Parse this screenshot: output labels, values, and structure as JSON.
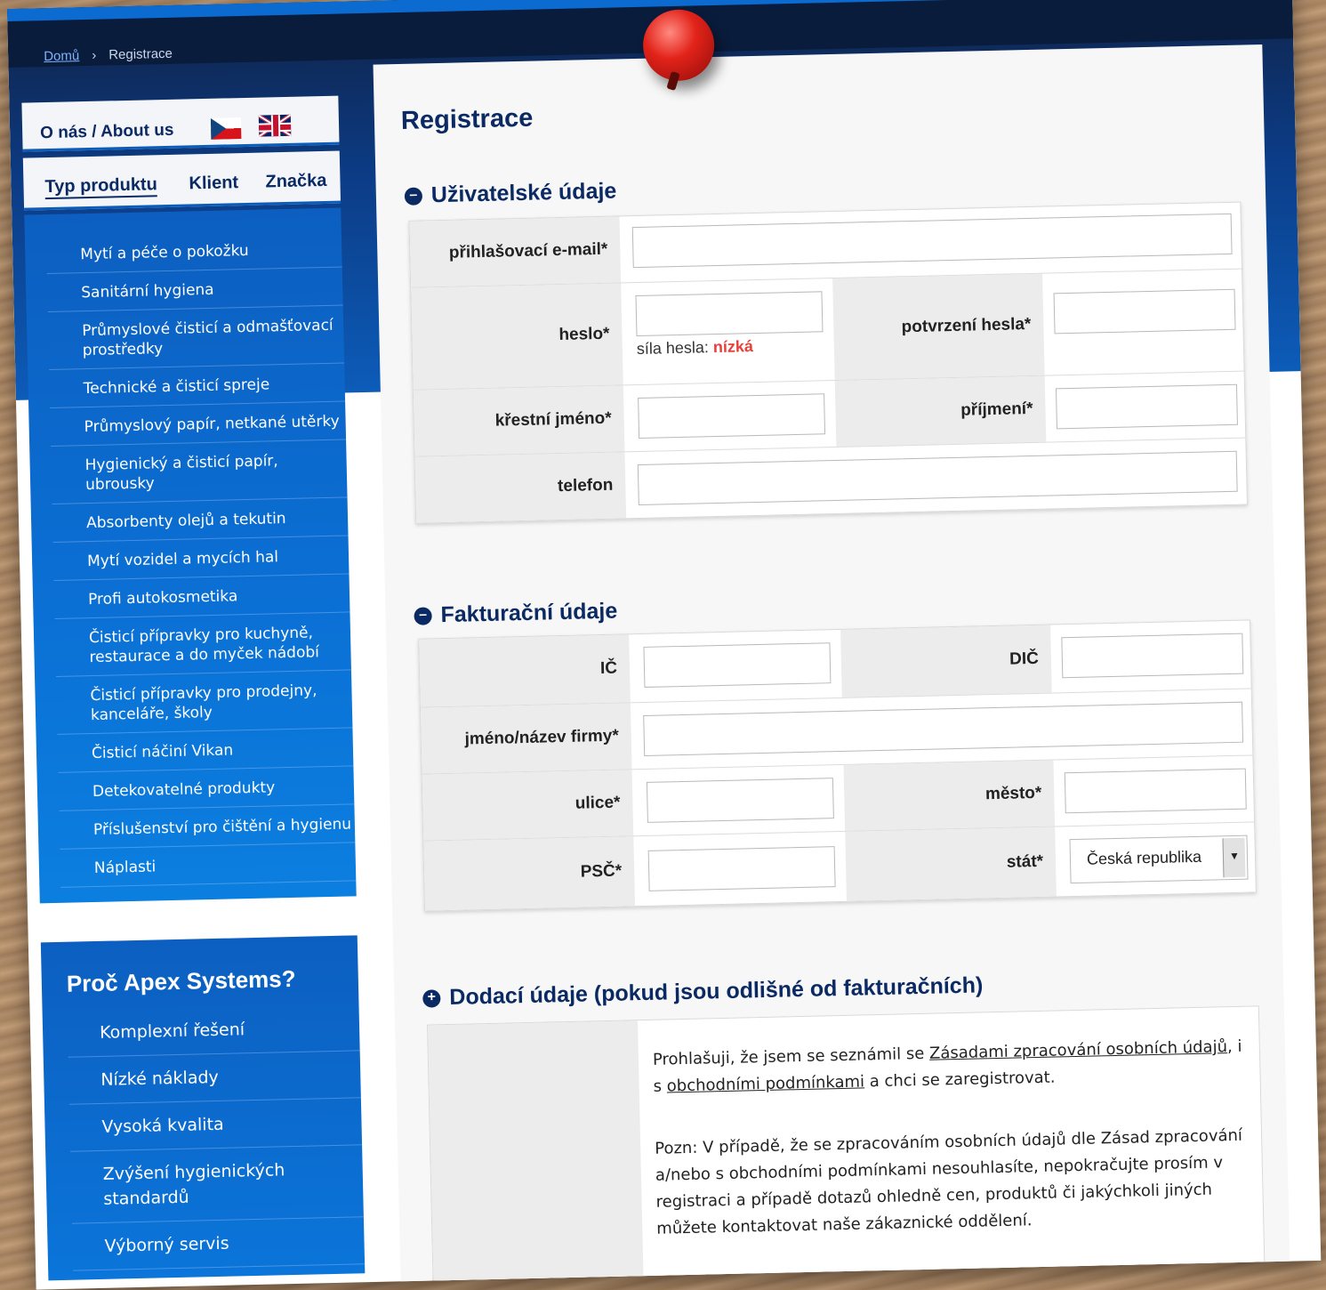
{
  "breadcrumb": {
    "home": "Domů",
    "current": "Registrace"
  },
  "lang": {
    "label": "O nás / About us"
  },
  "tabs": {
    "product_type": "Typ produktu",
    "client": "Klient",
    "brand": "Značka"
  },
  "categories": [
    "Mytí a péče o pokožku",
    "Sanitární hygiena",
    "Průmyslové čisticí a odmašťovací prostředky",
    "Technické a čisticí spreje",
    "Průmyslový papír, netkané utěrky",
    "Hygienický a čisticí papír, ubrousky",
    "Absorbenty olejů a tekutin",
    "Mytí vozidel a mycích hal",
    "Profi autokosmetika",
    "Čisticí přípravky pro kuchyně, restaurace a do myček nádobí",
    "Čisticí přípravky pro prodejny, kanceláře, školy",
    "Čisticí náčiní Vikan",
    "Detekovatelné produkty",
    "Příslušenství pro čištění a hygienu",
    "Náplasti"
  ],
  "why": {
    "title": "Proč Apex Systems?",
    "items": [
      "Komplexní řešení",
      "Nízké náklady",
      "Vysoká kvalita",
      "Zvýšení hygienických standardů",
      "Výborný servis"
    ]
  },
  "page": {
    "title": "Registrace"
  },
  "user": {
    "title": "Uživatelské údaje",
    "email_label": "přihlašovací e-mail*",
    "password_label": "heslo*",
    "password_confirm_label": "potvrzení hesla*",
    "strength_label": "síla hesla:",
    "strength_value": "nízká",
    "first_name_label": "křestní jméno*",
    "last_name_label": "příjmení*",
    "phone_label": "telefon"
  },
  "billing": {
    "title": "Fakturační údaje",
    "ic_label": "IČ",
    "dic_label": "DIČ",
    "company_label": "jméno/název firmy*",
    "street_label": "ulice*",
    "city_label": "město*",
    "zip_label": "PSČ*",
    "country_label": "stát*",
    "country_value": "Česká republika"
  },
  "delivery": {
    "title": "Dodací údaje (pokud jsou odlišné od fakturačních)"
  },
  "declaration": {
    "pre": "Prohlašuji, že jsem se seznámil se ",
    "privacy_link": "Zásadami zpracování osobních údajů",
    "mid": ", i s ",
    "terms_link": "obchodními podmínkami",
    "post": " a chci se zaregistrovat.",
    "note": "Pozn: V případě, že se zpracováním osobních údajů dle Zásad zpracování a/nebo s obchodními podmínkami nesouhlasíte, nepokračujte prosím v registraci a případě dotazů ohledně cen, produktů či jakýchkoli jiných můžete kontaktovat naše zákaznické oddělení."
  },
  "colors": {
    "brand_dark": "#0b2a63",
    "brand_blue": "#0c5cb9",
    "strength_low": "#e6403a"
  }
}
